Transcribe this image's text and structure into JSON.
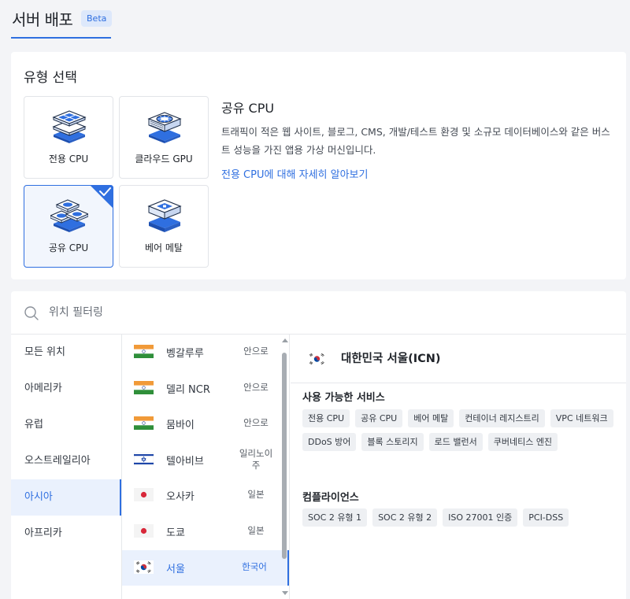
{
  "header": {
    "title": "서버 배포",
    "badge": "Beta"
  },
  "type_selection": {
    "heading": "유형 선택",
    "tiles": [
      {
        "label": "전용 CPU",
        "icon": "dedicated-cpu-icon",
        "selected": false
      },
      {
        "label": "클라우드 GPU",
        "icon": "cloud-gpu-icon",
        "selected": false
      },
      {
        "label": "공유 CPU",
        "icon": "shared-cpu-icon",
        "selected": true
      },
      {
        "label": "베어 메탈",
        "icon": "bare-metal-icon",
        "selected": false
      }
    ],
    "detail": {
      "title": "공유 CPU",
      "description": "트래픽이 적은 웹 사이트, 블로그, CMS, 개발/테스트 환경 및 소규모 데이터베이스와 같은 버스트 성능을 가진 앱용 가상 머신입니다.",
      "link": "전용 CPU에 대해 자세히 알아보기"
    }
  },
  "location": {
    "search_placeholder": "위치 필터링",
    "regions": [
      {
        "label": "모든 위치",
        "active": false
      },
      {
        "label": "아메리카",
        "active": false
      },
      {
        "label": "유럽",
        "active": false
      },
      {
        "label": "오스트레일리아",
        "active": false
      },
      {
        "label": "아시아",
        "active": true
      },
      {
        "label": "아프리카",
        "active": false
      }
    ],
    "cities": [
      {
        "name": "벵갈루루",
        "country": "안으로",
        "flag": "india-flag-icon"
      },
      {
        "name": "델리 NCR",
        "country": "안으로",
        "flag": "india-flag-icon"
      },
      {
        "name": "뭄바이",
        "country": "안으로",
        "flag": "india-flag-icon"
      },
      {
        "name": "텔아비브",
        "country": "일리노이 주",
        "flag": "israel-flag-icon"
      },
      {
        "name": "오사카",
        "country": "일본",
        "flag": "japan-flag-icon"
      },
      {
        "name": "도쿄",
        "country": "일본",
        "flag": "japan-flag-icon"
      },
      {
        "name": "서울",
        "country": "한국어",
        "flag": "korea-flag-icon"
      }
    ],
    "selected": {
      "title": "대한민국 서울(ICN)",
      "services_heading": "사용 가능한 서비스",
      "services": [
        "전용 CPU",
        "공유 CPU",
        "베어 메탈",
        "컨테이너 레지스트리",
        "VPC 네트워크",
        "DDoS 방어",
        "블록 스토리지",
        "로드 밸런서",
        "쿠버네티스 엔진"
      ],
      "compliance_heading": "컴플라이언스",
      "compliance": [
        "SOC 2 유형 1",
        "SOC 2 유형 2",
        "ISO 27001 인증",
        "PCI-DSS"
      ]
    }
  },
  "colors": {
    "accent": "#2f6fe0",
    "background": "#f3f4f7",
    "chip": "#eef0f3"
  }
}
